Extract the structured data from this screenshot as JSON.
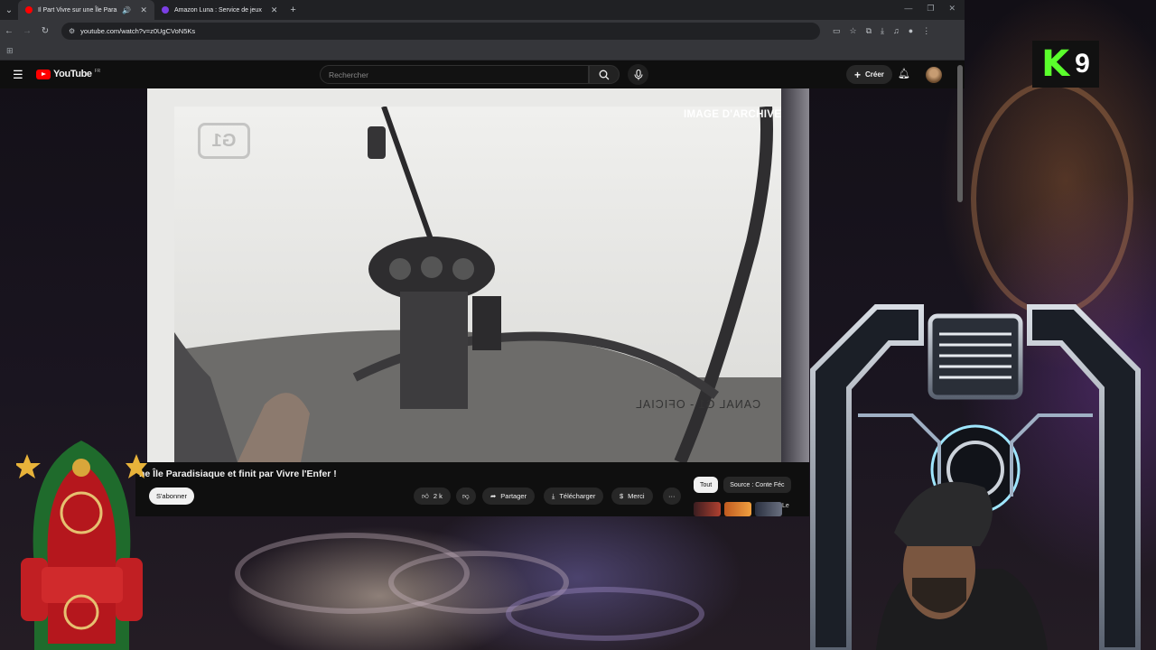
{
  "browser": {
    "tabs": [
      {
        "title": "Il Part Vivre sur une Île Para",
        "active": true,
        "favicon_color": "#ff0000",
        "audio_icon": "speaker-icon"
      },
      {
        "title": "Amazon Luna : Service de jeux",
        "active": false,
        "favicon_color": "#7b3fe4"
      }
    ],
    "new_tab": "+",
    "url": "youtube.com/watch?v=z0UgCVoN5Ks"
  },
  "youtube": {
    "logo_text": "YouTube",
    "logo_country": "FR",
    "search_placeholder": "Rechercher",
    "create_label": "Créer",
    "video": {
      "overlay_top": "IMAGE D'ARCHIVE",
      "overlay_bottom": "CANAL G1 - OFICIAL",
      "watermark": "G1"
    },
    "title": "ne Île Paradisiaque et finit par Vivre l'Enfer !",
    "subscribe_label": "S'abonner",
    "actions": {
      "likes": "2 k",
      "share": "Partager",
      "download": "Télécharger",
      "thanks": "Merci",
      "more": "···"
    },
    "chips": [
      {
        "label": "Tout",
        "selected": true
      },
      {
        "label": "Source : Conte Féc",
        "selected": false
      }
    ],
    "rec_snippet": "Le"
  },
  "overlay": {
    "badge_letter": "K",
    "badge_number": "9"
  },
  "colors": {
    "yt_red": "#ff0000",
    "k9_green": "#5aff2c",
    "bg_dark": "#0f0f0f"
  }
}
